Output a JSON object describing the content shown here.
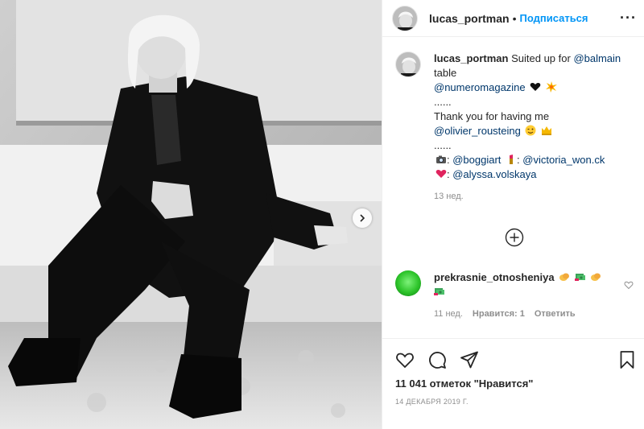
{
  "post": {
    "author": "lucas_portman",
    "separator": "•",
    "follow_label": "Подписаться",
    "more_label": "···"
  },
  "caption": {
    "username": "lucas_portman",
    "line1_text": " Suited up for ",
    "line1_mention": "@balmain",
    "line2_text": "table",
    "line3_mention": "@numeromagazine",
    "line4_text": "......",
    "line5_text": "Thank you for having me",
    "line6_mention": "@olivier_rousteing",
    "line7_text": "......",
    "line8_sep": ": ",
    "line8_mention1": "@boggiart",
    "line8_sep2": ": ",
    "line8_mention2": "@victoria_won.ck",
    "line9_sep": ": ",
    "line9_mention": "@alyssa.volskaya",
    "time": "13 нед."
  },
  "comment": {
    "username": "prekrasnie_otnosheniya",
    "time": "11 нед.",
    "likes": "Нравится: 1",
    "reply_label": "Ответить"
  },
  "actions": {
    "likes_count": "11 041 отметок \"Нравится\"",
    "date": "14 ДЕКАБРЯ 2019 Г."
  },
  "icons": [
    "heart-icon",
    "comment-icon",
    "share-icon",
    "bookmark-icon",
    "add-comment-icon",
    "more-icon",
    "next-arrow-icon"
  ],
  "colors": {
    "link": "#00376b",
    "follow": "#0095f6",
    "muted": "#8e8e8e",
    "text": "#262626"
  }
}
